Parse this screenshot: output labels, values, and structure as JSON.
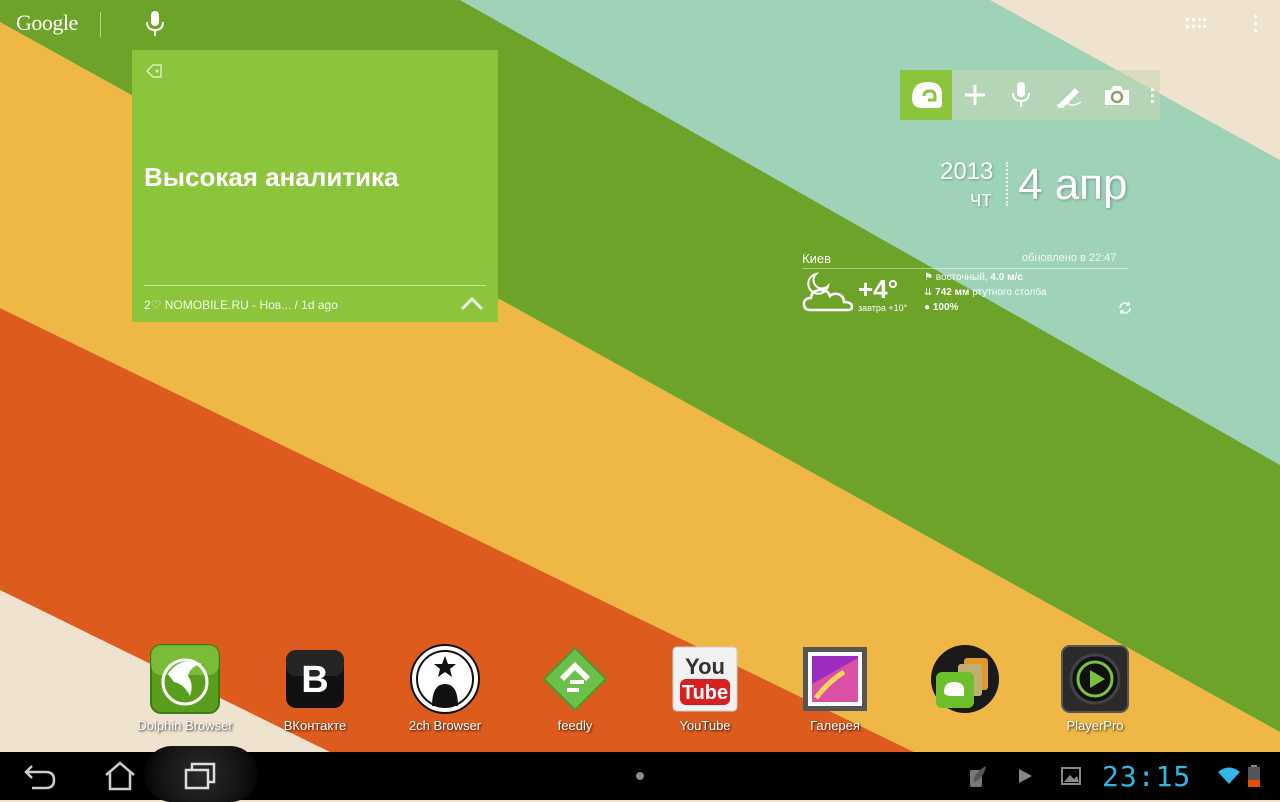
{
  "search_bar": {
    "logo_text": "Google"
  },
  "note_widget": {
    "title": "Высокая аналитика",
    "footer": "2♡ NOMOBILE.RU - Нов... / 1d ago"
  },
  "date_widget": {
    "year": "2013",
    "weekday": "чт",
    "date": "4 апр"
  },
  "weather": {
    "city": "Киев",
    "updated": "обновлено в 22:47",
    "temperature": "+4°",
    "tomorrow": "завтра +10°",
    "wind_label": "восточный,",
    "wind_value": "4.0 м/с",
    "pressure_value": "742 мм",
    "pressure_label": "ртутного столба",
    "humidity": "100%"
  },
  "dock": {
    "apps": [
      {
        "label": "Dolphin Browser",
        "icon": "dolphin-browser-icon"
      },
      {
        "label": "ВКонтакте",
        "icon": "vkontakte-icon"
      },
      {
        "label": "2ch Browser",
        "icon": "2ch-browser-icon"
      },
      {
        "label": "feedly",
        "icon": "feedly-icon"
      },
      {
        "label": "YouTube",
        "icon": "youtube-icon"
      },
      {
        "label": "Галерея",
        "icon": "gallery-icon"
      },
      {
        "label": "",
        "icon": "evernote-folder-icon"
      },
      {
        "label": "PlayerPro",
        "icon": "playerpro-icon"
      }
    ]
  },
  "status_bar": {
    "time": "23:15"
  },
  "colors": {
    "wallpaper_green": "#6ca328",
    "wallpaper_mint": "#9fd3b8",
    "wallpaper_yellow": "#efb746",
    "wallpaper_orange": "#de5b1e",
    "wallpaper_cream": "#efe3cf",
    "note_green": "#8cc43c",
    "clock_blue": "#33b5e5"
  }
}
